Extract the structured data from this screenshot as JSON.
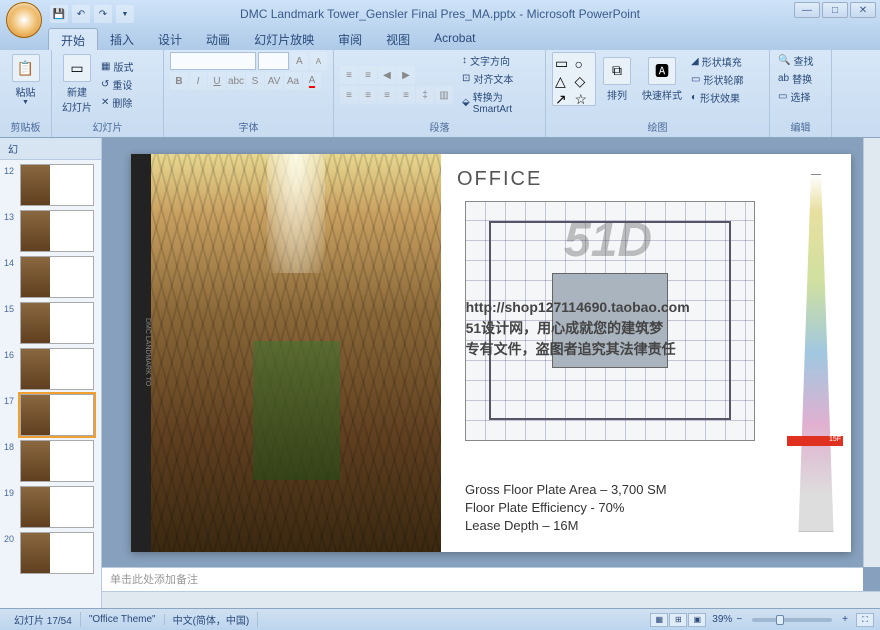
{
  "title": "DMC Landmark Tower_Gensler Final Pres_MA.pptx - Microsoft PowerPoint",
  "tabs": [
    "开始",
    "插入",
    "设计",
    "动画",
    "幻灯片放映",
    "审阅",
    "视图",
    "Acrobat"
  ],
  "ribbon": {
    "clipboard": {
      "paste": "粘贴",
      "label": "剪贴板"
    },
    "slides": {
      "new_slide": "新建\n幻灯片",
      "layout": "版式",
      "reset": "重设",
      "delete": "删除",
      "label": "幻灯片"
    },
    "font": {
      "grow": "A",
      "shrink": "A",
      "label": "字体"
    },
    "paragraph": {
      "text_dir": "文字方向",
      "align_text": "对齐文本",
      "smartart": "转换为 SmartArt",
      "label": "段落"
    },
    "drawing": {
      "arrange": "排列",
      "quick_styles": "快速样式",
      "shape_fill": "形状填充",
      "shape_outline": "形状轮廓",
      "shape_effects": "形状效果",
      "label": "绘图"
    },
    "editing": {
      "find": "查找",
      "replace": "替换",
      "select": "选择",
      "label": "编辑"
    }
  },
  "panel_tab": "幻",
  "thumbs": [
    12,
    13,
    14,
    15,
    16,
    17,
    18,
    19,
    20
  ],
  "selected_thumb": 17,
  "slide": {
    "sidebar_text": "DMC LANDMARK TO",
    "title": "OFFICE",
    "watermark_logo": "51D",
    "watermark_url": "http://shop127114690.taobao.com",
    "watermark_l1": "51设计网，用心成就您的建筑梦",
    "watermark_l2": "专有文件，盗图者追究其法律责任",
    "stat1": "Gross Floor Plate Area – 3,700 SM",
    "stat2": "Floor Plate Efficiency - 70%",
    "stat3": "Lease Depth – 16M",
    "tower_marker": "15F"
  },
  "notes_placeholder": "单击此处添加备注",
  "status": {
    "slide_count": "幻灯片 17/54",
    "theme": "\"Office Theme\"",
    "lang": "中文(简体，中国)",
    "zoom": "39%"
  }
}
